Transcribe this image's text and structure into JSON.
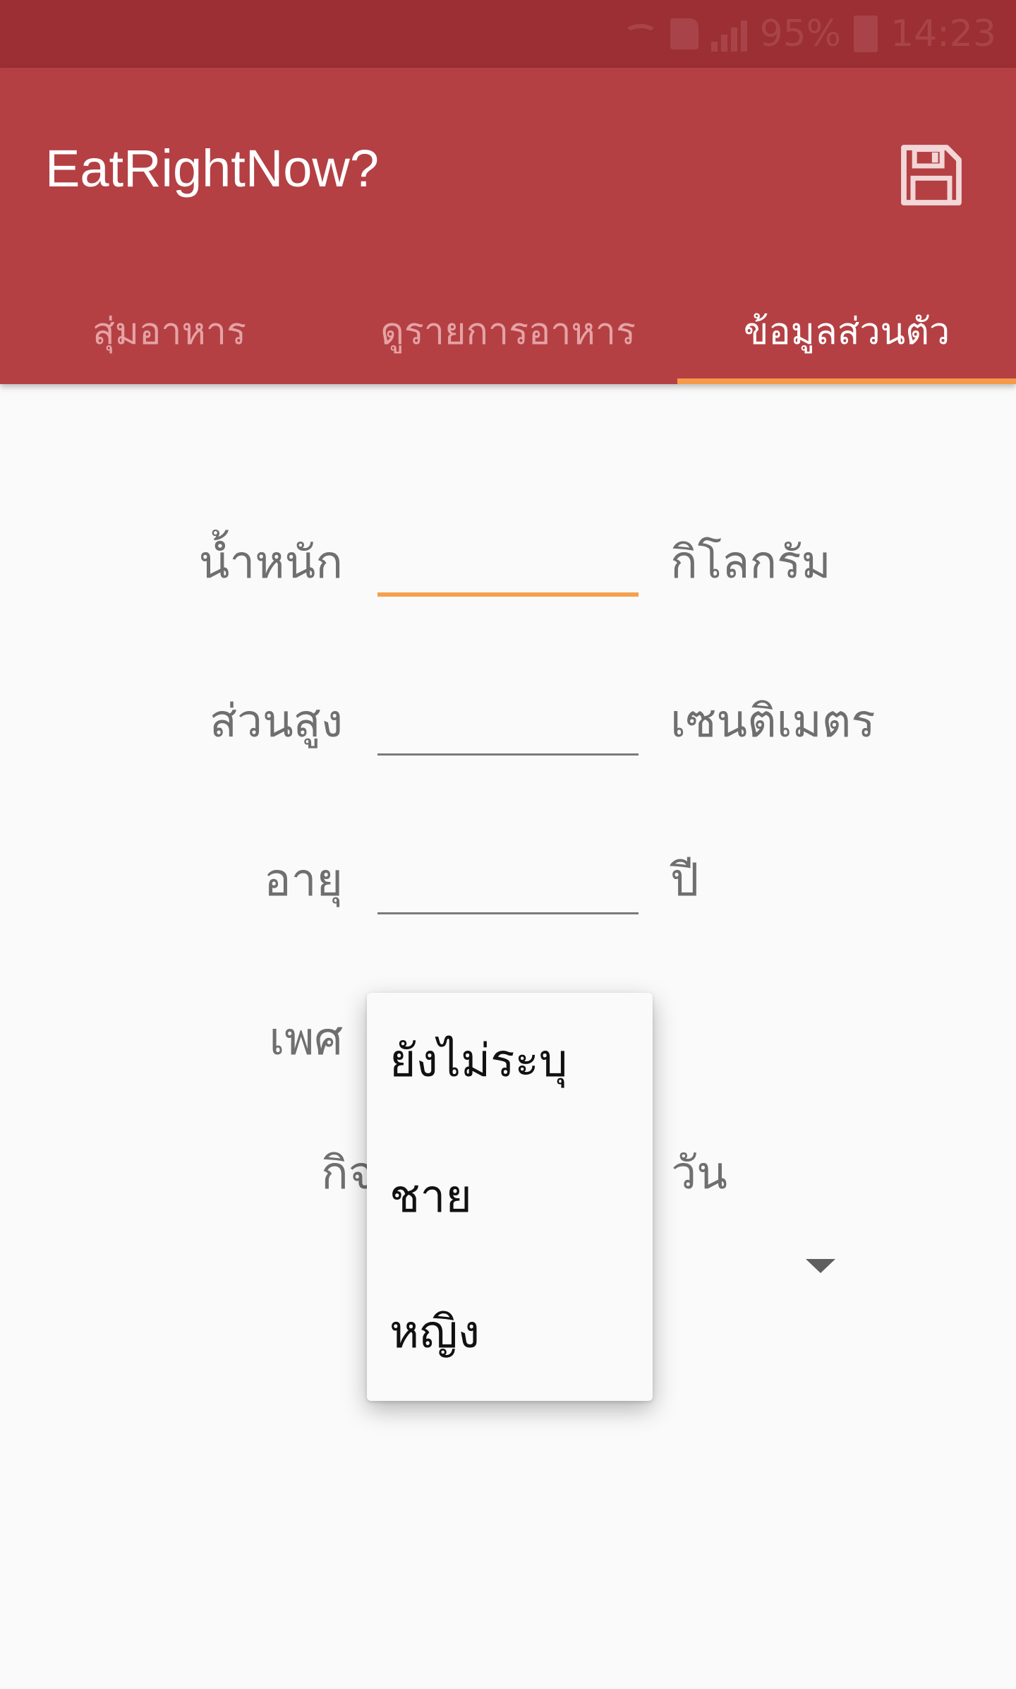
{
  "status_bar": {
    "battery_percent": "95%",
    "time": "14:23",
    "icons": [
      "wifi-icon",
      "sd-card-icon",
      "signal-icon",
      "battery-icon"
    ]
  },
  "app_bar": {
    "title": "EatRightNow?",
    "save_icon": "save-icon",
    "background_color": "#b44044"
  },
  "tabs": [
    {
      "label": "สุ่มอาหาร",
      "selected": false
    },
    {
      "label": "ดูรายการอาหาร",
      "selected": false
    },
    {
      "label": "ข้อมูลส่วนตัว",
      "selected": true
    }
  ],
  "form": {
    "weight": {
      "label": "น้ำหนัก",
      "value": "",
      "unit": "กิโลกรัม"
    },
    "height": {
      "label": "ส่วนสูง",
      "value": "",
      "unit": "เซนติเมตร"
    },
    "age": {
      "label": "อายุ",
      "value": "",
      "unit": "ปี"
    },
    "gender": {
      "label": "เพศ"
    },
    "activity": {
      "label_start": "กิจ",
      "label_end": "วัน"
    }
  },
  "gender_dropdown": {
    "options": [
      "ยังไม่ระบุ",
      "ชาย",
      "หญิง"
    ]
  },
  "colors": {
    "status_bar": "#9c2f33",
    "accent": "#f59a49"
  }
}
